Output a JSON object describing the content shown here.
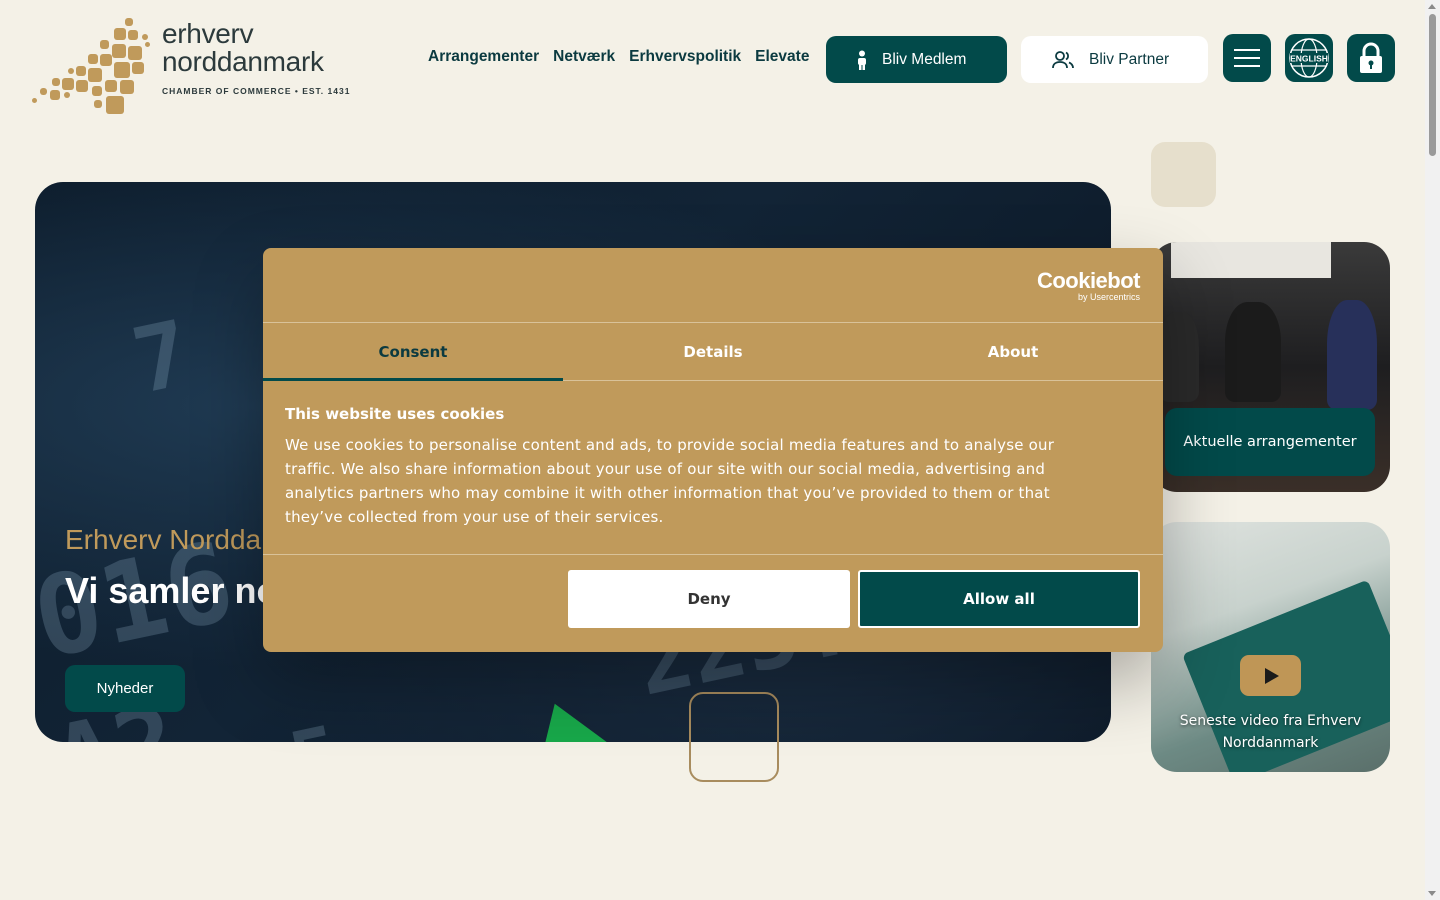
{
  "header": {
    "logo": {
      "line1": "erhverv",
      "line2": "norddanmark",
      "tagline": "CHAMBER OF COMMERCE  •  EST. 1431"
    },
    "nav": [
      {
        "label": "Arrangementer"
      },
      {
        "label": "Netværk"
      },
      {
        "label": "Erhvervspolitik"
      },
      {
        "label": "Elevate"
      }
    ],
    "member_button": "Bliv Medlem",
    "partner_button": "Bliv Partner",
    "icons": {
      "menu": "hamburger-menu-icon",
      "english": "english-globe-icon",
      "login": "lock-icon"
    },
    "english_label": "ENGLISH"
  },
  "hero": {
    "eyebrow": "Erhverv Nordda",
    "title": "Vi samler nordjysk er",
    "button": "Nyheder"
  },
  "sidebar": {
    "events_card": {
      "label": "Aktuelle arrangementer"
    },
    "video_card": {
      "caption": "Seneste video fra Erhverv Norddanmark"
    }
  },
  "cookie_dialog": {
    "brand": "Cookiebot",
    "brand_sub": "by Usercentrics",
    "tabs": [
      {
        "label": "Consent",
        "active": true
      },
      {
        "label": "Details",
        "active": false
      },
      {
        "label": "About",
        "active": false
      }
    ],
    "title": "This website uses cookies",
    "text": "We use cookies to personalise content and ads, to provide social media features and to analyse our traffic. We also share information about your use of our site with our social media, advertising and analytics partners who may combine it with other information that you’ve provided to them or that they’ve collected from your use of their services.",
    "deny_button": "Deny",
    "allow_button": "Allow all"
  },
  "colors": {
    "background": "#f4f1e7",
    "primary_teal": "#024a4a",
    "gold": "#c09a5b",
    "text_dark": "#0b3a40"
  }
}
